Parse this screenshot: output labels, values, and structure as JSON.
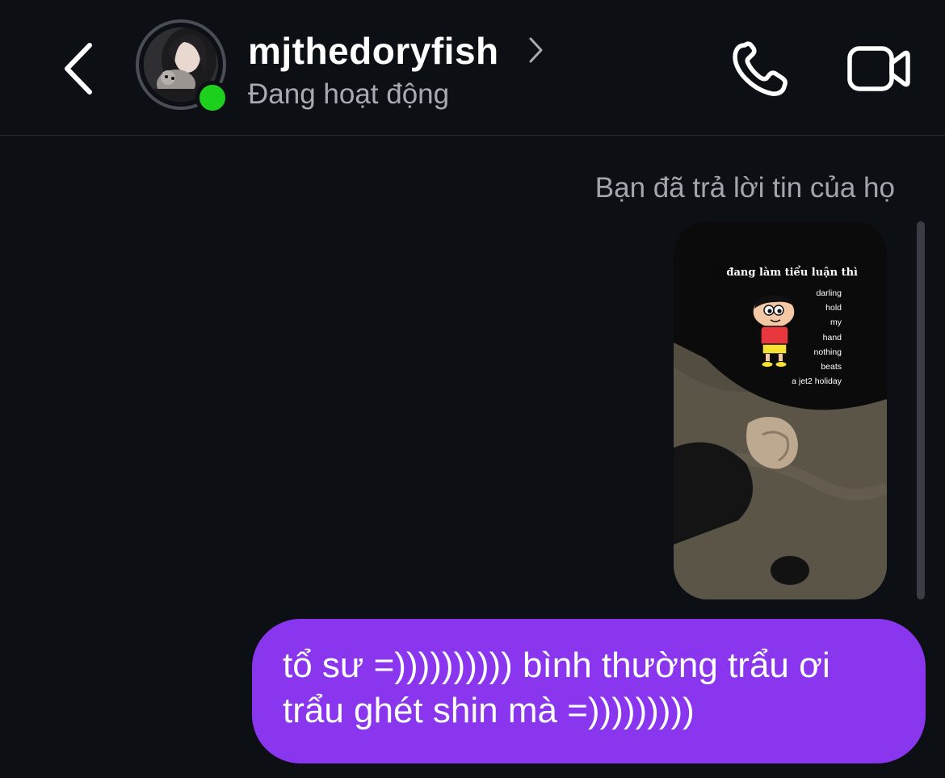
{
  "header": {
    "username": "mjthedoryfish",
    "status": "Đang hoạt động",
    "icons": {
      "back": "chevron-left-icon",
      "profile_chevron": "chevron-right-icon",
      "call": "phone-icon",
      "video": "video-camera-icon"
    },
    "online_color": "#1ed01e"
  },
  "conversation": {
    "reply_caption": "Bạn đã trả lời tin của họ",
    "story": {
      "title": "đang làm tiểu luận thì",
      "lines": [
        "darling",
        "hold",
        "my",
        "hand",
        "nothing",
        "beats",
        "a jet2 holiday"
      ]
    },
    "message": {
      "lines": [
        "tổ sư =)))))))))) bình thường trẩu ơi",
        "trẩu ghét shin mà =)))))))))"
      ],
      "bubble_color": "#8a35ee"
    }
  }
}
